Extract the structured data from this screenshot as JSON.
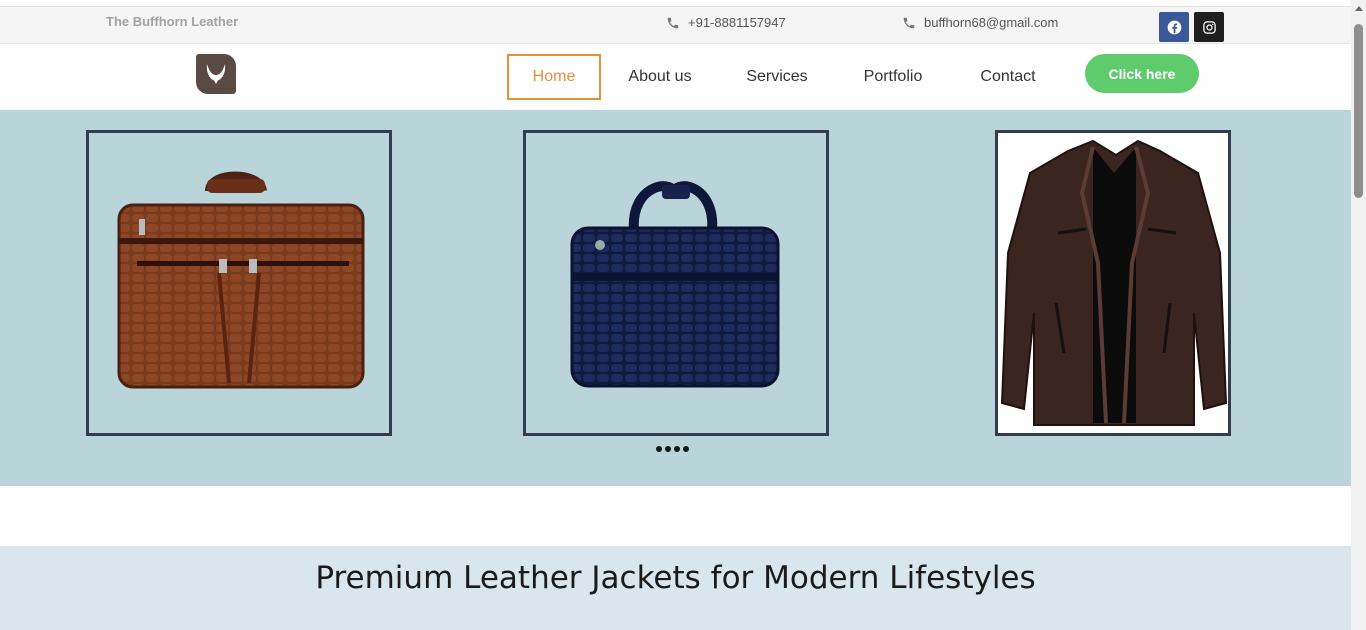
{
  "topbar": {
    "brand": "The Buffhorn Leather",
    "phone": "+91-8881157947",
    "email": "buffhorn68@gmail.com",
    "phone_icon": "phone-icon",
    "social": [
      "facebook-icon",
      "instagram-icon"
    ]
  },
  "nav": {
    "items": [
      "Home",
      "About us",
      "Services",
      "Portfolio",
      "Contact"
    ],
    "active": "Home",
    "cta": "Click here"
  },
  "hero": {
    "slides": [
      "brown-leather-laptop-bag",
      "navy-croc-leather-laptop-bag",
      "brown-leather-jacket"
    ],
    "dot_count": 4
  },
  "section": {
    "headline": "Premium Leather Jackets for Modern Lifestyles"
  },
  "colors": {
    "accent": "#e3913b",
    "cta": "#5ecc6c",
    "hero_bg": "#b9d5da",
    "band_bg": "#d9e6ed"
  }
}
